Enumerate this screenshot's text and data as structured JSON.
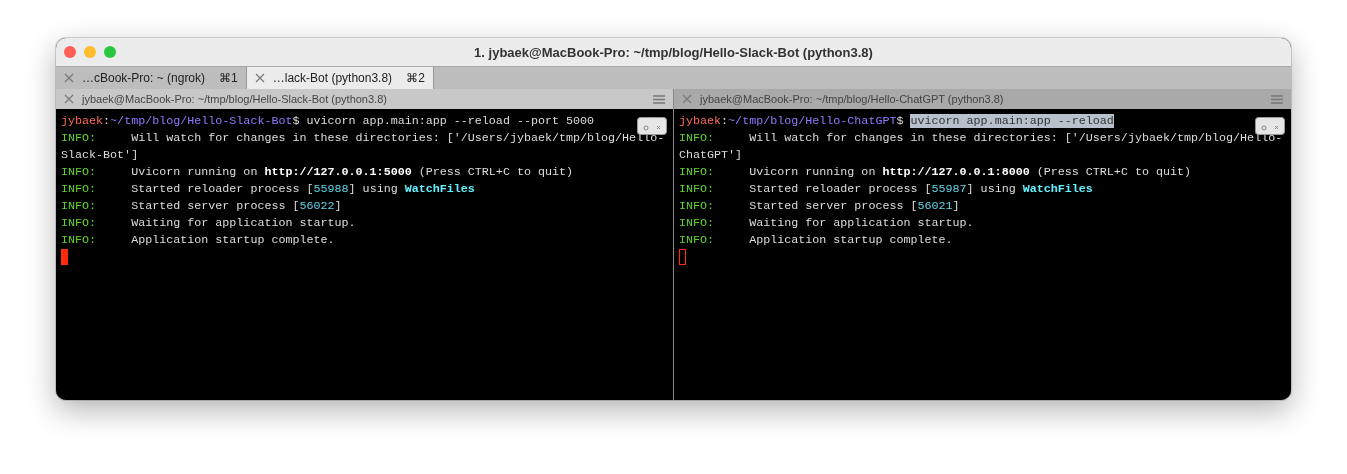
{
  "window": {
    "title": "1. jybaek@MacBook-Pro: ~/tmp/blog/Hello-Slack-Bot (python3.8)"
  },
  "tabs": [
    {
      "label": "…cBook-Pro: ~ (ngrok)",
      "shortcut": "⌘1",
      "selected": false
    },
    {
      "label": "…lack-Bot (python3.8)",
      "shortcut": "⌘2",
      "selected": true
    }
  ],
  "panes": [
    {
      "title": "jybaek@MacBook-Pro: ~/tmp/blog/Hello-Slack-Bot (python3.8)",
      "focused": true,
      "lines": [
        [
          {
            "kind": "user",
            "text": "jybaek"
          },
          {
            "kind": "plain",
            "text": ":"
          },
          {
            "kind": "path",
            "text": "~/tmp/blog/Hello-Slack-Bot"
          },
          {
            "kind": "plain",
            "text": "$ uvicorn app.main:app --reload --port 5000"
          }
        ],
        [
          {
            "kind": "info",
            "text": "INFO:"
          },
          {
            "kind": "plain",
            "text": "     Will watch for changes in these directories: ['/Users/jybaek/tmp/blog/Hello-"
          }
        ],
        [
          {
            "kind": "plain",
            "text": "Slack-Bot']"
          }
        ],
        [
          {
            "kind": "info",
            "text": "INFO:"
          },
          {
            "kind": "plain",
            "text": "     Uvicorn running on "
          },
          {
            "kind": "bold",
            "text": "http://127.0.0.1:5000"
          },
          {
            "kind": "plain",
            "text": " (Press CTRL+C to quit)"
          }
        ],
        [
          {
            "kind": "info",
            "text": "INFO:"
          },
          {
            "kind": "plain",
            "text": "     Started reloader process ["
          },
          {
            "kind": "num",
            "text": "55988"
          },
          {
            "kind": "plain",
            "text": "] using "
          },
          {
            "kind": "watch",
            "text": "WatchFiles"
          }
        ],
        [
          {
            "kind": "info",
            "text": "INFO:"
          },
          {
            "kind": "plain",
            "text": "     Started server process ["
          },
          {
            "kind": "num",
            "text": "56022"
          },
          {
            "kind": "plain",
            "text": "]"
          }
        ],
        [
          {
            "kind": "info",
            "text": "INFO:"
          },
          {
            "kind": "plain",
            "text": "     Waiting for application startup."
          }
        ],
        [
          {
            "kind": "info",
            "text": "INFO:"
          },
          {
            "kind": "plain",
            "text": "     Application startup complete."
          }
        ]
      ]
    },
    {
      "title": "jybaek@MacBook-Pro: ~/tmp/blog/Hello-ChatGPT (python3.8)",
      "focused": false,
      "lines": [
        [
          {
            "kind": "user",
            "text": "jybaek"
          },
          {
            "kind": "plain",
            "text": ":"
          },
          {
            "kind": "path",
            "text": "~/tmp/blog/Hello-ChatGPT"
          },
          {
            "kind": "plain",
            "text": "$ "
          },
          {
            "kind": "selected",
            "text": "uvicorn app.main:app --reload"
          }
        ],
        [
          {
            "kind": "info",
            "text": "INFO:"
          },
          {
            "kind": "plain",
            "text": "     Will watch for changes in these directories: ['/Users/jybaek/tmp/blog/Hello-"
          }
        ],
        [
          {
            "kind": "plain",
            "text": "ChatGPT']"
          }
        ],
        [
          {
            "kind": "info",
            "text": "INFO:"
          },
          {
            "kind": "plain",
            "text": "     Uvicorn running on "
          },
          {
            "kind": "bold",
            "text": "http://127.0.0.1:8000"
          },
          {
            "kind": "plain",
            "text": " (Press CTRL+C to quit)"
          }
        ],
        [
          {
            "kind": "info",
            "text": "INFO:"
          },
          {
            "kind": "plain",
            "text": "     Started reloader process ["
          },
          {
            "kind": "num",
            "text": "55987"
          },
          {
            "kind": "plain",
            "text": "] using "
          },
          {
            "kind": "watch",
            "text": "WatchFiles"
          }
        ],
        [
          {
            "kind": "info",
            "text": "INFO:"
          },
          {
            "kind": "plain",
            "text": "     Started server process ["
          },
          {
            "kind": "num",
            "text": "56021"
          },
          {
            "kind": "plain",
            "text": "]"
          }
        ],
        [
          {
            "kind": "info",
            "text": "INFO:"
          },
          {
            "kind": "plain",
            "text": "     Waiting for application startup."
          }
        ],
        [
          {
            "kind": "info",
            "text": "INFO:"
          },
          {
            "kind": "plain",
            "text": "     Application startup complete."
          }
        ]
      ]
    }
  ]
}
